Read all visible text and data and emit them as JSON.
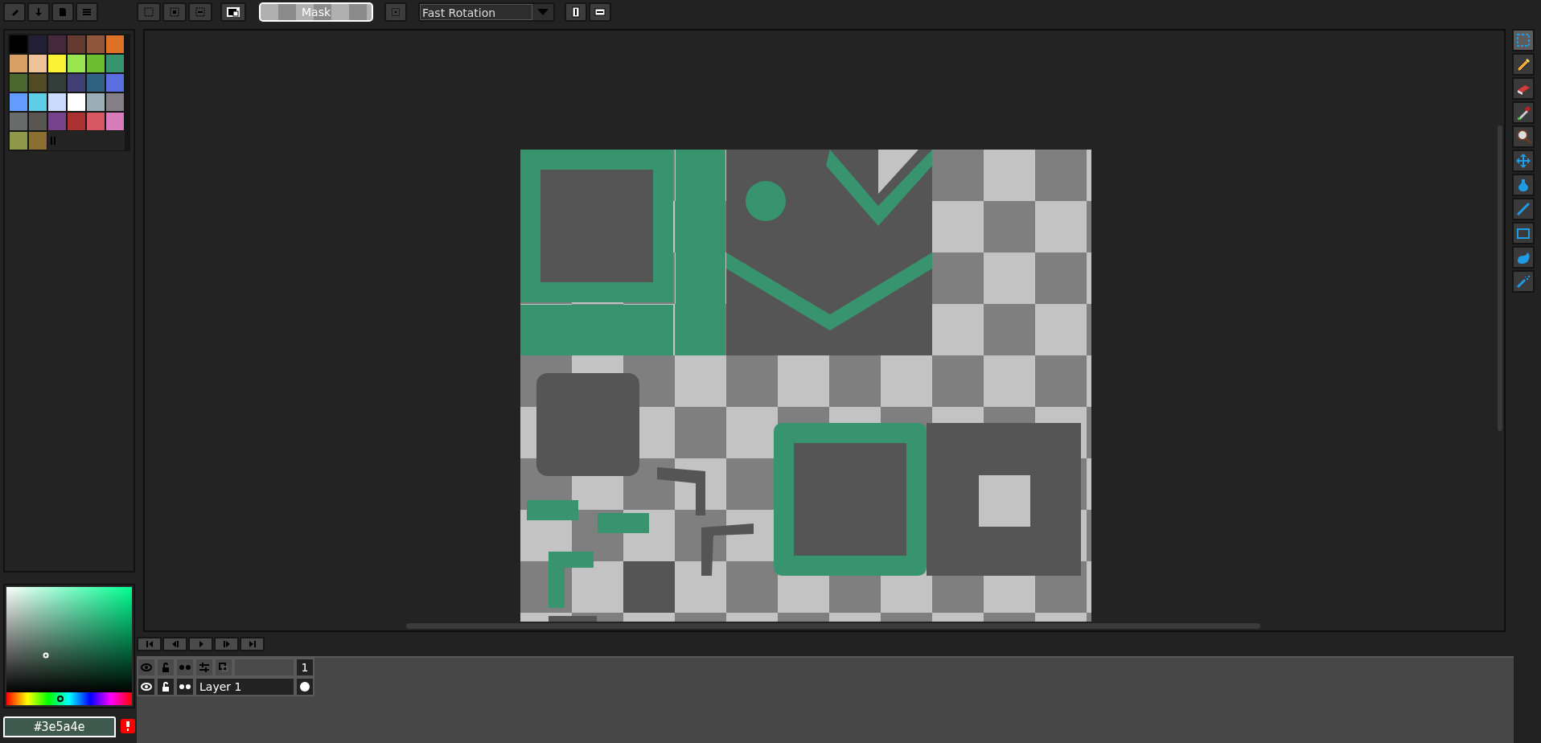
{
  "toolbar": {
    "mask_label": "Mask",
    "rotation_mode": "Fast Rotation"
  },
  "palette": {
    "colors": [
      {
        "color": "#000000"
      },
      {
        "color": "#222034"
      },
      {
        "color": "#45283c"
      },
      {
        "color": "#663931"
      },
      {
        "color": "#8f563b"
      },
      {
        "color": "#df7126"
      },
      {
        "color": "#d9a066"
      },
      {
        "color": "#eec39a"
      },
      {
        "color": "#fbf236"
      },
      {
        "color": "#99e550"
      },
      {
        "color": "#6abe30"
      },
      {
        "color": "#37946e"
      },
      {
        "color": "#4b692f"
      },
      {
        "color": "#524b24"
      },
      {
        "color": "#323c39"
      },
      {
        "color": "#3f3f74"
      },
      {
        "color": "#306082"
      },
      {
        "color": "#5b6ee1"
      },
      {
        "color": "#639bff"
      },
      {
        "color": "#5fcde4"
      },
      {
        "color": "#cbdbfc"
      },
      {
        "color": "#ffffff"
      },
      {
        "color": "#9badb7"
      },
      {
        "color": "#847e87"
      },
      {
        "color": "#696a6a"
      },
      {
        "color": "#595652"
      },
      {
        "color": "#76428a"
      },
      {
        "color": "#ac3232"
      },
      {
        "color": "#d95763"
      },
      {
        "color": "#d77bba"
      },
      {
        "color": "#8f974a"
      },
      {
        "color": "#8a6f30"
      }
    ]
  },
  "color_picker": {
    "hex": "#3e5a4e",
    "hue_slider": {
      "level": 0.43
    }
  },
  "tools": [
    {
      "kind": "select",
      "selected": true
    },
    {
      "kind": "pencil",
      "selected": false
    },
    {
      "kind": "eraser",
      "selected": false
    },
    {
      "kind": "picker",
      "selected": false
    },
    {
      "kind": "zoom",
      "selected": false
    },
    {
      "kind": "move",
      "selected": false
    },
    {
      "kind": "bucket",
      "selected": false
    },
    {
      "kind": "line",
      "selected": false
    },
    {
      "kind": "rectangle",
      "selected": false
    },
    {
      "kind": "blob",
      "selected": false
    },
    {
      "kind": "spray",
      "selected": false
    }
  ],
  "timeline": {
    "frames": [
      {
        "label": "1"
      }
    ],
    "layers": [
      {
        "name": "Layer 1",
        "visible": true,
        "locked": false,
        "cel_filled": true
      }
    ]
  }
}
